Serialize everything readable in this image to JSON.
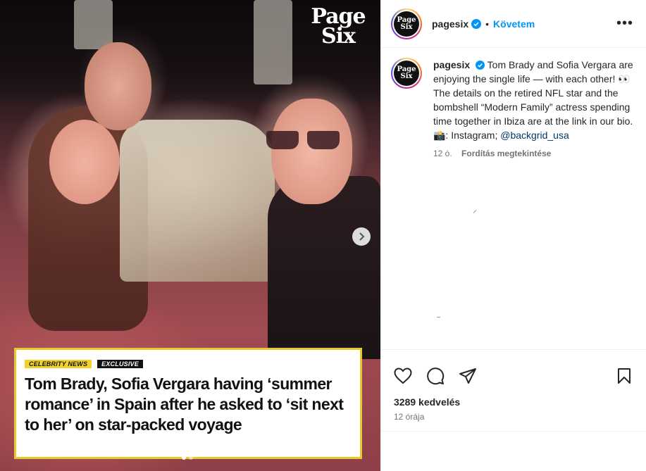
{
  "media": {
    "logo_line1": "Page",
    "logo_line2": "Six",
    "tags": [
      "CELEBRITY NEWS",
      "EXCLUSIVE"
    ],
    "headline": "Tom Brady, Sofia Vergara having ‘summer romance’ in Spain after he asked to ‘sit next to her’ on star-packed voyage",
    "carousel_index": 1,
    "carousel_total": 2
  },
  "header": {
    "avatar_line1": "Page",
    "avatar_line2": "Six",
    "username": "pagesix",
    "separator": "•",
    "follow_label": "Követem",
    "more_icon": "more-horizontal-icon"
  },
  "caption": {
    "username": "pagesix",
    "text": "Tom Brady and Sofia Vergara are enjoying the single life — with each other! 👀 The details on the retired NFL star and the bombshell “Modern Family” actress spending time together in Ibiza are at the link in our bio. 📸: Instagram;",
    "mention": "@backgrid_usa",
    "age": "12 ó.",
    "translate_label": "Fordítás megtekintése"
  },
  "actions": {
    "like_icon": "heart-icon",
    "comment_icon": "comment-icon",
    "share_icon": "share-icon",
    "save_icon": "bookmark-icon"
  },
  "likes": "3289 kedvelés",
  "timestamp": "12 órája",
  "colors": {
    "accent": "#0095f6",
    "verified": "#0095f6",
    "tag_yellow": "#f3d227",
    "headline_border": "#e8c82a"
  }
}
